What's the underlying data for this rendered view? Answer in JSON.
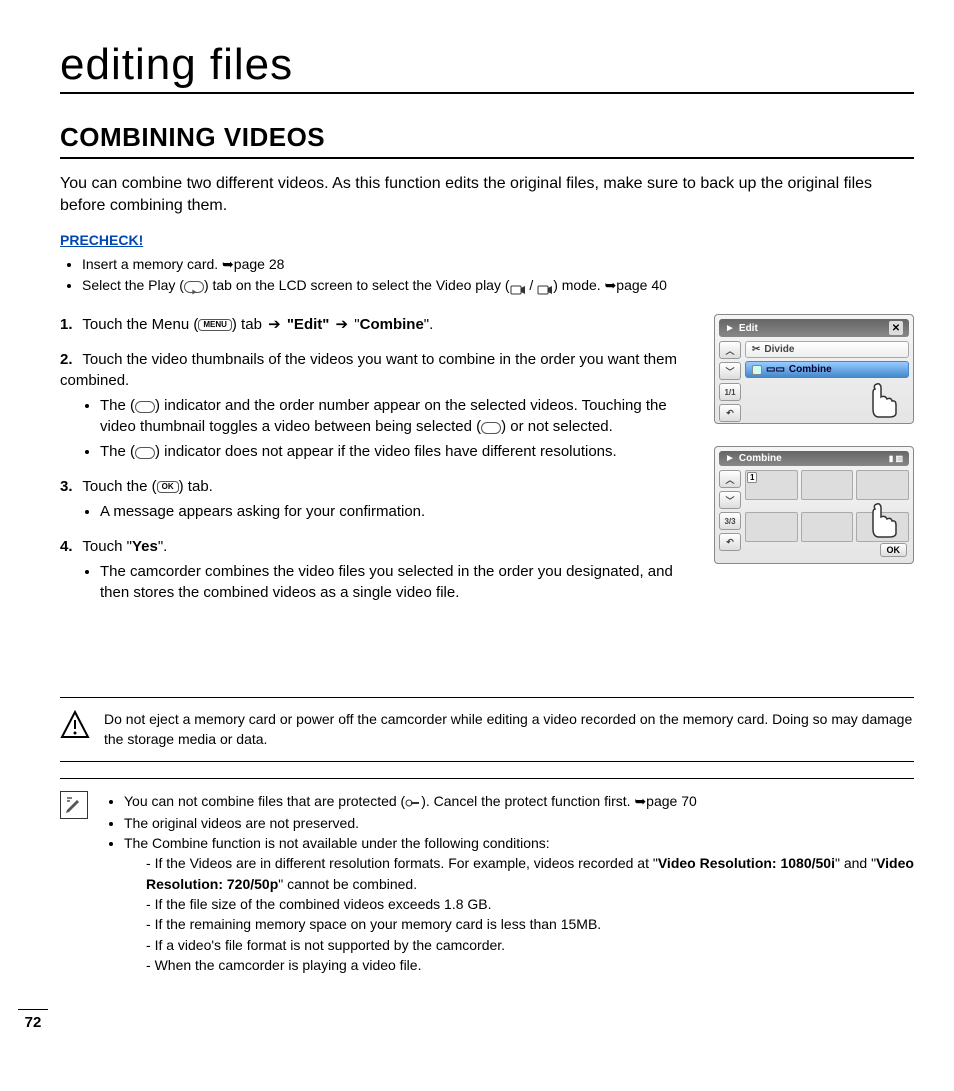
{
  "page_number": "72",
  "chapter_title": "editing files",
  "section_title": "COMBINING VIDEOS",
  "intro": "You can combine two different videos. As this function edits the original files, make sure to back up the original files before combining them.",
  "precheck_label": "PRECHECK!",
  "precheck": {
    "item1_a": "Insert a memory card. ",
    "item1_b": "page 28",
    "item2_a": "Select the Play (",
    "item2_b": ") tab on the LCD screen to select the Video play (",
    "item2_c": " / ",
    "item2_d": ") mode. ",
    "item2_e": "page 40"
  },
  "icons": {
    "menu": "MENU",
    "ok": "OK",
    "arrow_right": "➔",
    "go": "➥"
  },
  "steps": {
    "s1_a": "Touch the Menu (",
    "s1_b": ") tab ",
    "s1_c": " \"Edit\" ",
    "s1_d": " \"",
    "s1_e": "Combine",
    "s1_f": "\".",
    "s2": "Touch the video thumbnails of the videos you want to combine in the order you want them combined.",
    "s2_b1_a": "The (",
    "s2_b1_b": ") indicator and the order number appear on the selected videos. Touching the video thumbnail toggles a video between being selected (",
    "s2_b1_c": ") or not selected.",
    "s2_b2_a": "The (",
    "s2_b2_b": ") indicator does not appear if the video files have different resolutions.",
    "s3_a": "Touch the (",
    "s3_b": ") tab.",
    "s3_b1": "A message appears asking for your confirmation.",
    "s4_a": "Touch \"",
    "s4_b": "Yes",
    "s4_c": "\".",
    "s4_b1": "The camcorder combines the video files you selected in the order you designated, and then stores the combined videos as a single video file."
  },
  "warning": "Do not eject a memory card or power off the camcorder while editing a video recorded on the memory card. Doing so may damage the storage media or data.",
  "notes": {
    "n1_a": "You can not combine files that are protected (",
    "n1_b": "). Cancel the protect function first. ",
    "n1_c": "page 70",
    "n2": "The original videos are not preserved.",
    "n3": "The Combine function is not available under the following conditions:",
    "d1_a": "If the Videos are in different resolution formats. For example, videos recorded at \"",
    "d1_b": "Video Resolution: 1080/50i",
    "d1_c": "\" and \"",
    "d1_d": "Video Resolution: 720/50p",
    "d1_e": "\" cannot be combined.",
    "d2": "If the file size of the combined videos exceeds 1.8 GB.",
    "d3": "If the remaining memory space on your memory card is less than 15MB.",
    "d4": "If a video's file format is not supported by the camcorder.",
    "d5": "When the camcorder is playing a video file."
  },
  "screen1": {
    "title": "Edit",
    "item_divide": "Divide",
    "item_combine": "Combine",
    "pager": "1/1"
  },
  "screen2": {
    "title": "Combine",
    "pager": "3/3",
    "thumb_label": "1",
    "ok": "OK"
  }
}
